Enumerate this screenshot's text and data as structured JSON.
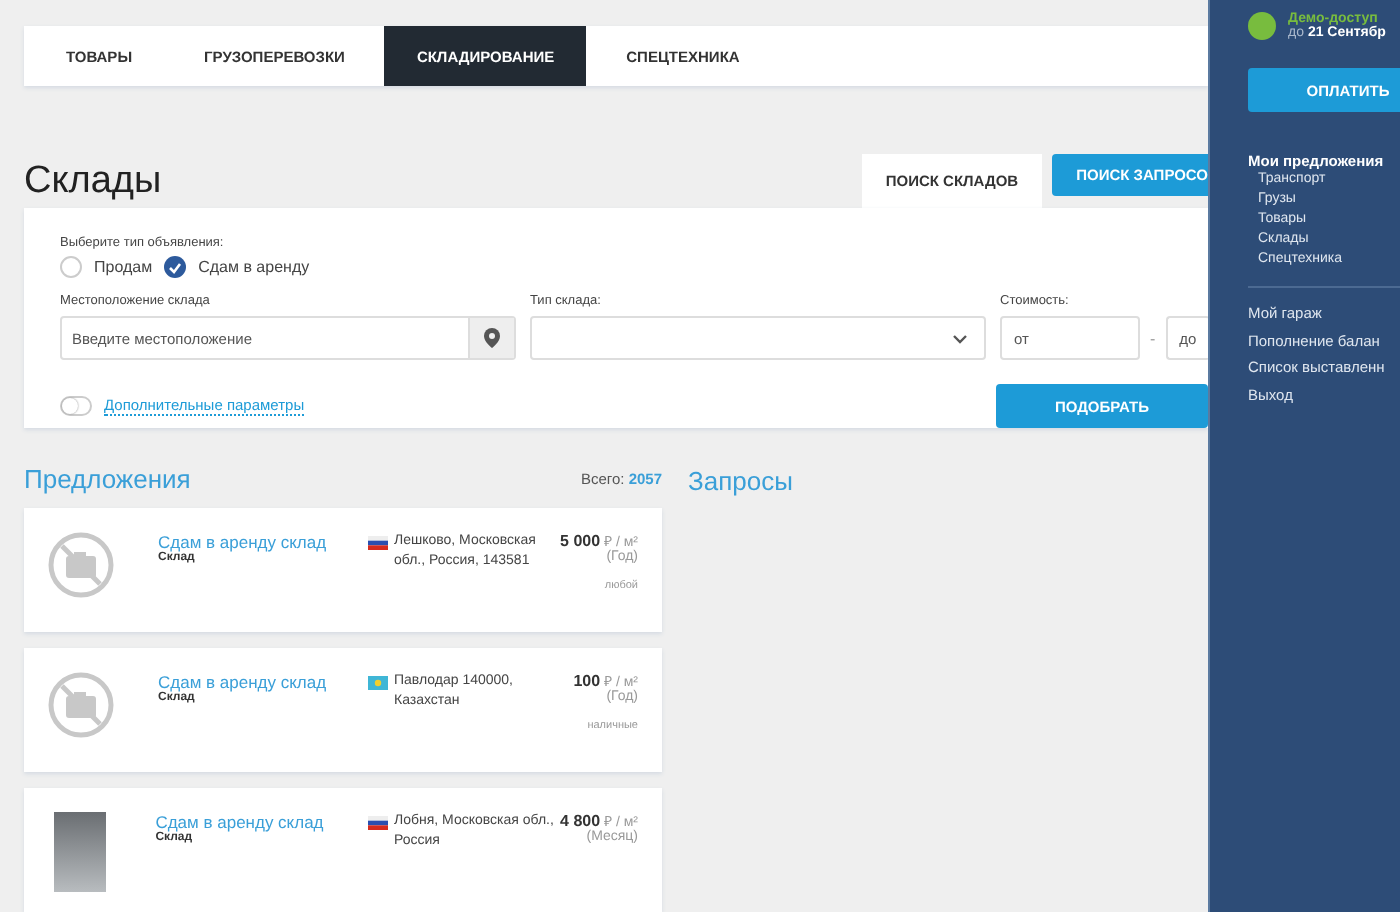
{
  "nav": [
    {
      "label": "ТОВАРЫ",
      "selected": false
    },
    {
      "label": "ГРУЗОПЕРЕВОЗКИ",
      "selected": false
    },
    {
      "label": "СКЛАДИРОВАНИЕ",
      "selected": true
    },
    {
      "label": "СПЕЦТЕХНИКА",
      "selected": false
    }
  ],
  "title": "Склады",
  "search_tabs": [
    {
      "label": "ПОИСК СКЛАДОВ",
      "selected": true
    },
    {
      "label": "ПОИСК ЗАПРОСО",
      "selected": false
    }
  ],
  "form": {
    "type_label": "Выберите тип объявления:",
    "types": [
      {
        "label": "Продам",
        "selected": false
      },
      {
        "label": "Сдам в аренду",
        "selected": true
      }
    ],
    "location_label": "Местоположение склада",
    "location_placeholder": "Введите местоположение",
    "kind_label": "Тип склада:",
    "cost_label": "Стоимость:",
    "cost_from": "от",
    "cost_dash": "-",
    "cost_to": "до",
    "extra": {
      "label": "Дополнительные параметры",
      "on": false
    },
    "submit": "ПОДОБРАТЬ"
  },
  "offers": {
    "title": "Предложения",
    "total_label": "Всего:",
    "total": "2057",
    "items": [
      {
        "kind": "nophoto",
        "title": "Сдам в аренду склад",
        "subtitle": "Склад",
        "location": {
          "kind": "ru",
          "text": "Лешково, Московская обл., Россия, 143581"
        },
        "price": "**5 000** ₽ / м² (Год)",
        "payment": "любой"
      },
      {
        "kind": "nophoto",
        "title": "Сдам в аренду склад",
        "subtitle": "Склад",
        "location": {
          "kind": "kz",
          "text": "Павлодар 140000, Казахстан"
        },
        "price": "**100** ₽ / м² (Год)",
        "payment": "наличные"
      },
      {
        "kind": "photo",
        "title": "Сдам в аренду склад",
        "subtitle": "Склад",
        "location": {
          "kind": "ru",
          "text": "Лобня, Московская обл., Россия"
        },
        "price": "**4 800** ₽ / м² (Месяц)"
      }
    ]
  },
  "requests": {
    "title": "Запросы"
  },
  "sidebar": {
    "status": "Демо-доступ",
    "until_prefix": "до",
    "until_date": "21 Сентябр",
    "pay_button": "ОПЛАТИТЬ",
    "offers_title": "Мои предложения",
    "offers_items": [
      "Транспорт",
      "Грузы",
      "Товары",
      "Склады",
      "Спецтехника"
    ],
    "links": [
      "Мой гараж",
      "Пополнение балан",
      "Список выставленн",
      "Выход"
    ]
  }
}
